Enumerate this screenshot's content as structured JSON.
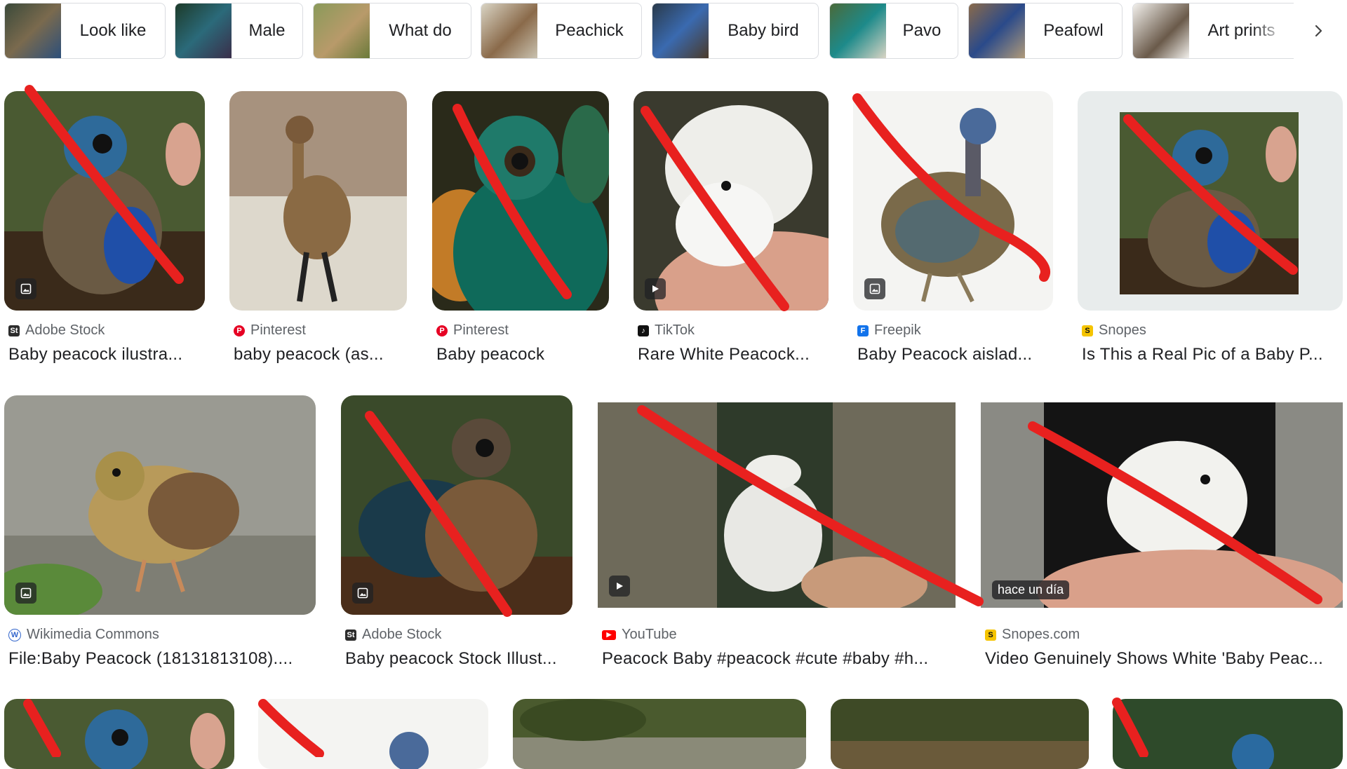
{
  "chips": [
    {
      "label": "Look like"
    },
    {
      "label": "Male"
    },
    {
      "label": "What do"
    },
    {
      "label": "Peachick"
    },
    {
      "label": "Baby bird"
    },
    {
      "label": "Pavo"
    },
    {
      "label": "Peafowl"
    },
    {
      "label": "Art prints"
    }
  ],
  "chip_next_icon": "chevron-right-icon",
  "results_row1": [
    {
      "source": "Adobe Stock",
      "title": "Baby peacock ilustra...",
      "badge": "image-icon",
      "crossed": true
    },
    {
      "source": "Pinterest",
      "title": "baby peacock (as...",
      "badge": "",
      "crossed": false
    },
    {
      "source": "Pinterest",
      "title": "Baby peacock",
      "badge": "",
      "crossed": true
    },
    {
      "source": "TikTok",
      "title": "Rare White Peacock...",
      "badge": "play-icon",
      "crossed": true
    },
    {
      "source": "Freepik",
      "title": "Baby Peacock aislad...",
      "badge": "image-icon",
      "crossed": true
    },
    {
      "source": "Snopes",
      "title": "Is This a Real Pic of a Baby P...",
      "badge": "",
      "crossed": true
    }
  ],
  "results_row2": [
    {
      "source": "Wikimedia Commons",
      "title": "File:Baby Peacock (18131813108)....",
      "badge": "image-icon",
      "crossed": false
    },
    {
      "source": "Adobe Stock",
      "title": "Baby peacock Stock Illust...",
      "badge": "image-icon",
      "crossed": true
    },
    {
      "source": "YouTube",
      "title": "Peacock Baby #peacock #cute #baby #h...",
      "badge": "play-icon",
      "crossed": true
    },
    {
      "source": "Snopes.com",
      "title": "Video Genuinely Shows White 'Baby Peac...",
      "badge": "",
      "tag": "hace un día",
      "crossed": true
    }
  ],
  "colors": {
    "annotation_red": "#e8211f",
    "pinterest": "#e60023",
    "youtube": "#ff0000",
    "freepik": "#1273eb",
    "snopes": "#f5c400",
    "adobe": "#2c2c2c",
    "wikimedia": "#3366cc"
  }
}
